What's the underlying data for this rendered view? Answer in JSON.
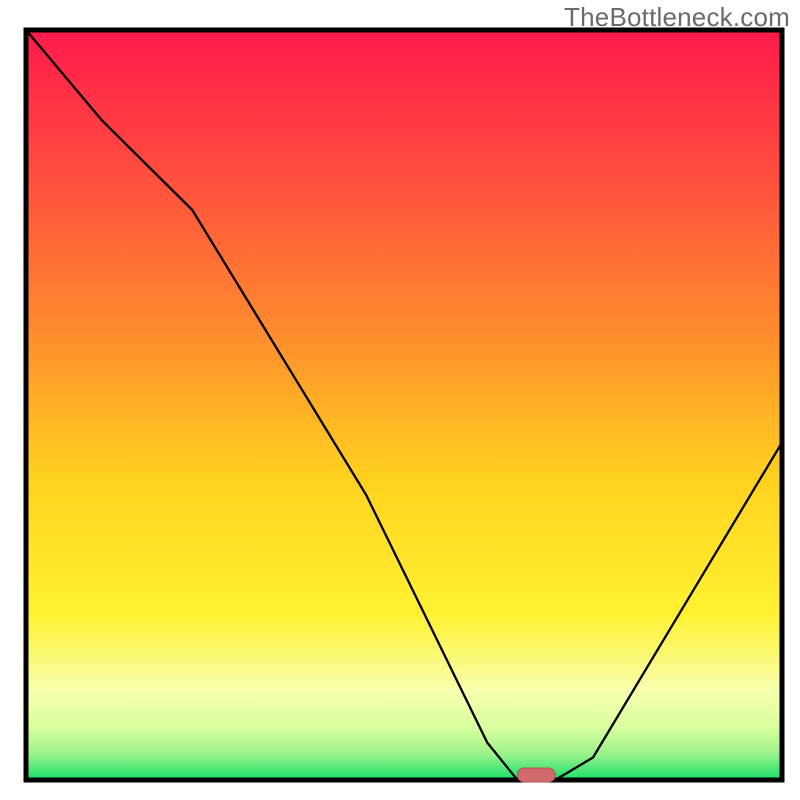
{
  "watermark": "TheBottleneck.com",
  "chart_data": {
    "type": "line",
    "title": "",
    "xlabel": "",
    "ylabel": "",
    "xlim": [
      0,
      100
    ],
    "ylim": [
      0,
      100
    ],
    "x": [
      0,
      10,
      22,
      45,
      61,
      65,
      70,
      75,
      100
    ],
    "values": [
      100,
      88,
      76,
      38,
      5,
      0,
      0,
      3,
      45
    ],
    "marker": {
      "x": 67.5,
      "y": 0
    },
    "gradient_stops": [
      {
        "offset": 0,
        "color": "#ff1a4b"
      },
      {
        "offset": 0.18,
        "color": "#ff4a3f"
      },
      {
        "offset": 0.4,
        "color": "#ff8b2e"
      },
      {
        "offset": 0.6,
        "color": "#ffd21f"
      },
      {
        "offset": 0.78,
        "color": "#fff233"
      },
      {
        "offset": 0.88,
        "color": "#f8ffae"
      },
      {
        "offset": 0.93,
        "color": "#d9ff9e"
      },
      {
        "offset": 0.965,
        "color": "#9cf28b"
      },
      {
        "offset": 1.0,
        "color": "#18e06a"
      }
    ],
    "border_color": "#000000",
    "line_color": "#000000",
    "marker_fill": "#d16a6a",
    "marker_stroke": "#b84f4f"
  }
}
